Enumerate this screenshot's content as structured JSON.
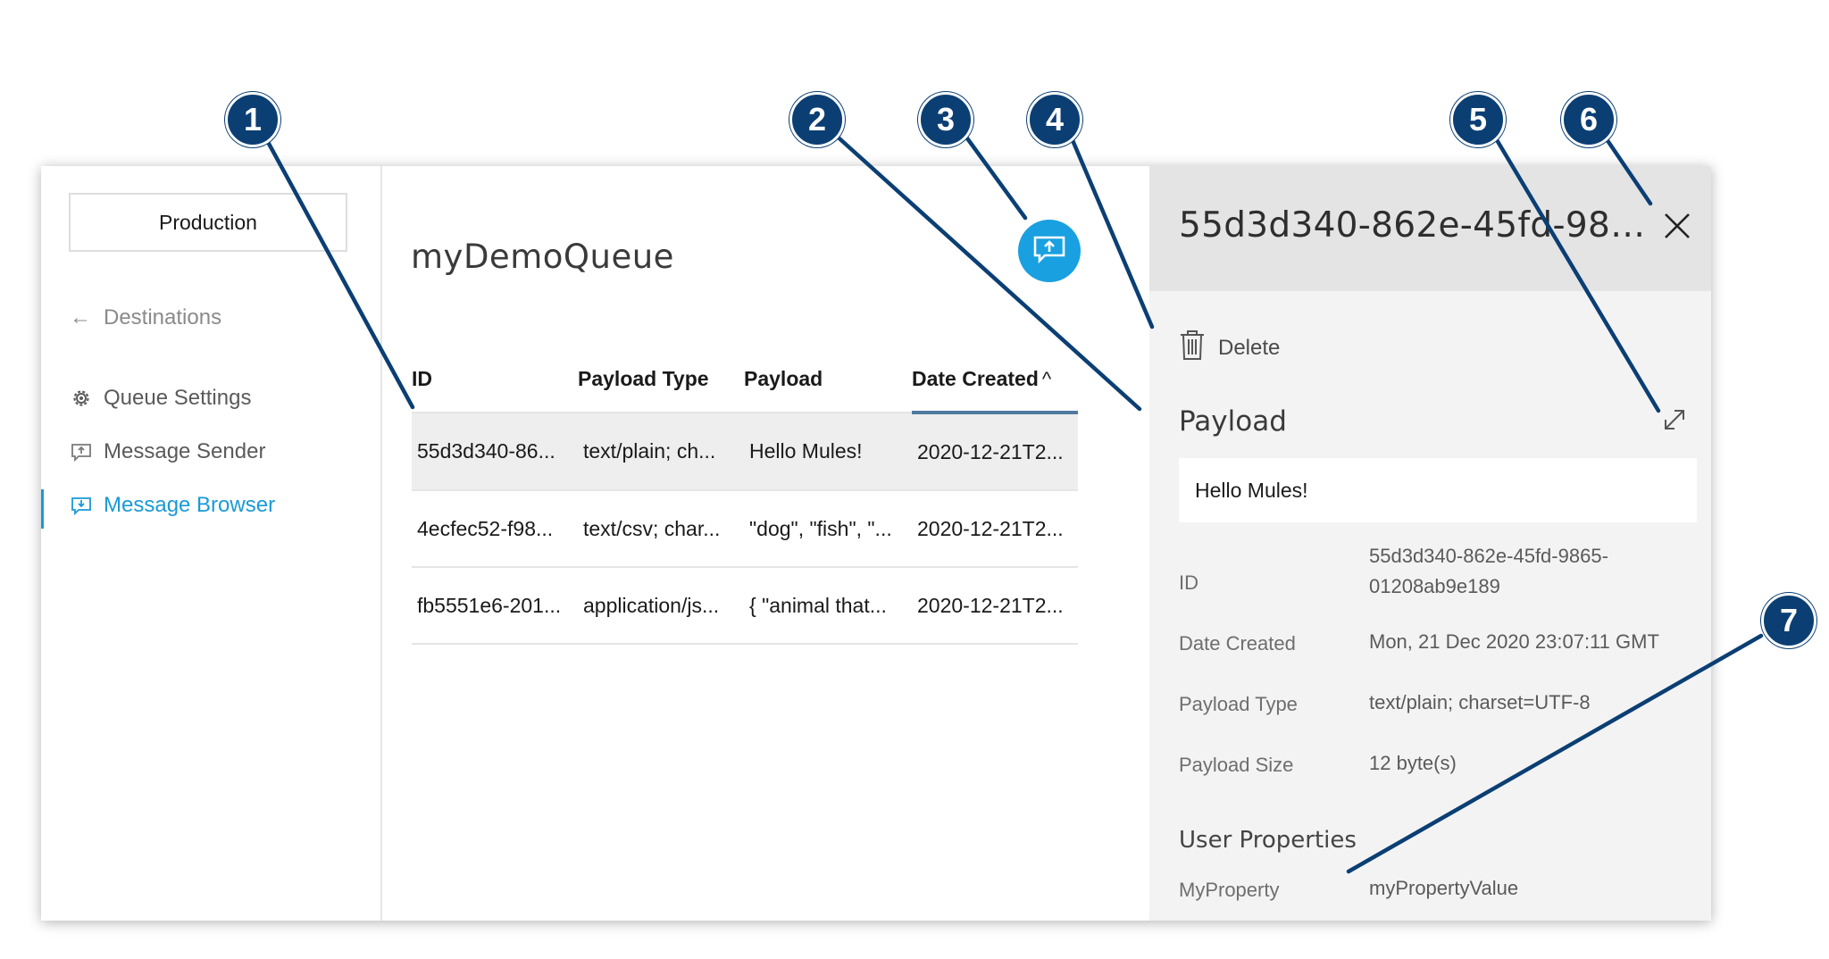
{
  "sidebar": {
    "environment": "Production",
    "back_label": "Destinations",
    "items": [
      {
        "label": "Queue Settings",
        "icon": "gear-icon"
      },
      {
        "label": "Message Sender",
        "icon": "send-message-icon"
      },
      {
        "label": "Message Browser",
        "icon": "browse-message-icon",
        "active": true
      }
    ]
  },
  "main": {
    "queue_name": "myDemoQueue",
    "columns": [
      "ID",
      "Payload Type",
      "Payload",
      "Date Created"
    ],
    "sort_indicator": "^",
    "rows": [
      {
        "id": "55d3d340-86...",
        "type": "text/plain; ch...",
        "payload": "Hello Mules!",
        "date": "2020-12-21T2..."
      },
      {
        "id": "4ecfec52-f98...",
        "type": "text/csv; char...",
        "payload": "\"dog\", \"fish\", \"...",
        "date": "2020-12-21T2..."
      },
      {
        "id": "fb5551e6-201...",
        "type": "application/js...",
        "payload": "{ \"animal that...",
        "date": "2020-12-21T2..."
      }
    ]
  },
  "detail": {
    "title": "55d3d340-862e-45fd-9865-0...",
    "delete_label": "Delete",
    "payload_label": "Payload",
    "payload_value": "Hello Mules!",
    "props": [
      {
        "label": "ID",
        "value_line1": "55d3d340-862e-45fd-9865-",
        "value_line2": "01208ab9e189"
      },
      {
        "label": "Date Created",
        "value": "Mon, 21 Dec 2020 23:07:11 GMT"
      },
      {
        "label": "Payload Type",
        "value": "text/plain; charset=UTF-8"
      },
      {
        "label": "Payload Size",
        "value": "12 byte(s)"
      }
    ],
    "user_properties_title": "User Properties",
    "user_properties": [
      {
        "label": "MyProperty",
        "value": "myPropertyValue"
      }
    ]
  },
  "callouts": [
    "1",
    "2",
    "3",
    "4",
    "5",
    "6",
    "7"
  ],
  "colors": {
    "accent": "#1a9ad6",
    "send_button": "#19a0e0",
    "callout": "#0b3f74",
    "sort_underline": "#4f7aa0"
  }
}
